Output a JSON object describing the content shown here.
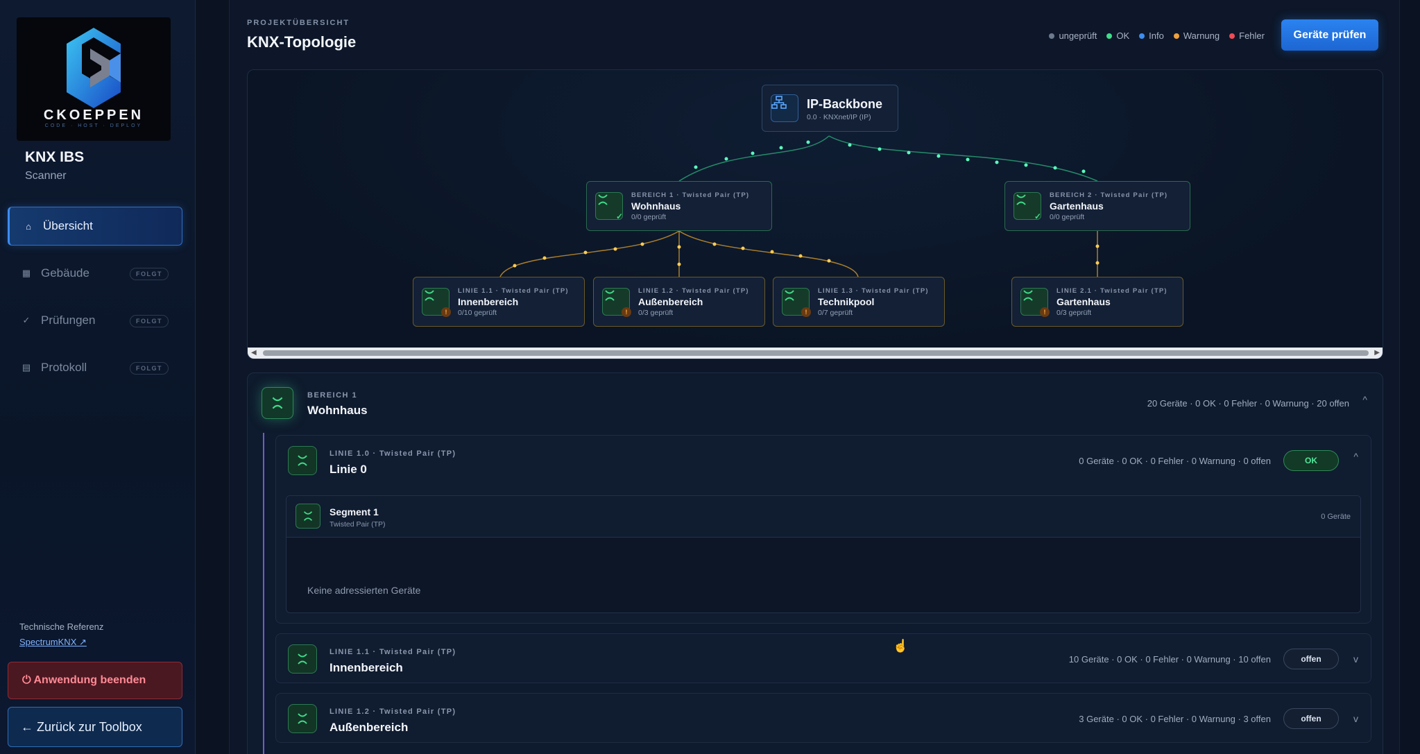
{
  "sidebar": {
    "logo_text": "CKOEPPEN",
    "logo_sub": "CODE · HOST · DEPLOY",
    "app_title": "KNX IBS",
    "app_sub": "Scanner",
    "nav": [
      {
        "label": "Übersicht",
        "icon": "home-icon",
        "badge": ""
      },
      {
        "label": "Gebäude",
        "icon": "building-icon",
        "badge": "FOLGT"
      },
      {
        "label": "Prüfungen",
        "icon": "check-icon",
        "badge": "FOLGT"
      },
      {
        "label": "Protokoll",
        "icon": "log-icon",
        "badge": "FOLGT"
      }
    ],
    "ref_label": "Technische Referenz",
    "ref_link": "SpectrumKNX ↗",
    "quit_label": "⏻ Anwendung beenden",
    "back_label": "← Zurück zur Toolbox"
  },
  "header": {
    "kicker": "PROJEKTÜBERSICHT",
    "title": "KNX-Topologie",
    "legend": [
      {
        "label": "ungeprüft",
        "color": "#6c7a90"
      },
      {
        "label": "OK",
        "color": "#3fdc8a"
      },
      {
        "label": "Info",
        "color": "#3d8cf0"
      },
      {
        "label": "Warnung",
        "color": "#f0a03c"
      },
      {
        "label": "Fehler",
        "color": "#f04a55"
      }
    ],
    "check_button": "Geräte prüfen"
  },
  "topology": {
    "backbone": {
      "name": "IP-Backbone",
      "meta": "0.0 · KNXnet/IP (IP)"
    },
    "areas": [
      {
        "kicker": "BEREICH 1 · Twisted Pair (TP)",
        "name": "Wohnhaus",
        "meta": "0/0 geprüft"
      },
      {
        "kicker": "BEREICH 2 · Twisted Pair (TP)",
        "name": "Gartenhaus",
        "meta": "0/0 geprüft"
      }
    ],
    "lines": [
      {
        "kicker": "LINIE 1.1 · Twisted Pair (TP)",
        "name": "Innenbereich",
        "meta": "0/10 geprüft"
      },
      {
        "kicker": "LINIE 1.2 · Twisted Pair (TP)",
        "name": "Außenbereich",
        "meta": "0/3 geprüft"
      },
      {
        "kicker": "LINIE 1.3 · Twisted Pair (TP)",
        "name": "Technikpool",
        "meta": "0/7 geprüft"
      },
      {
        "kicker": "LINIE 2.1 · Twisted Pair (TP)",
        "name": "Gartenhaus",
        "meta": "0/3 geprüft"
      }
    ]
  },
  "area_panel": {
    "kicker": "BEREICH 1",
    "name": "Wohnhaus",
    "stats": "20 Geräte · 0 OK · 0 Fehler · 0 Warnung · 20 offen",
    "lines": [
      {
        "kicker": "LINIE 1.0 · Twisted Pair (TP)",
        "name": "Linie 0",
        "stats": "0 Geräte · 0 OK · 0 Fehler · 0 Warnung · 0 offen",
        "status": "OK"
      },
      {
        "kicker": "LINIE 1.1 · Twisted Pair (TP)",
        "name": "Innenbereich",
        "stats": "10 Geräte · 0 OK · 0 Fehler · 0 Warnung · 10 offen",
        "status": "offen"
      },
      {
        "kicker": "LINIE 1.2 · Twisted Pair (TP)",
        "name": "Außenbereich",
        "stats": "3 Geräte · 0 OK · 0 Fehler · 0 Warnung · 3 offen",
        "status": "offen"
      }
    ],
    "segment": {
      "name": "Segment 1",
      "meta": "Twisted Pair (TP)",
      "count": "0 Geräte",
      "empty": "Keine adressierten Geräte"
    }
  }
}
